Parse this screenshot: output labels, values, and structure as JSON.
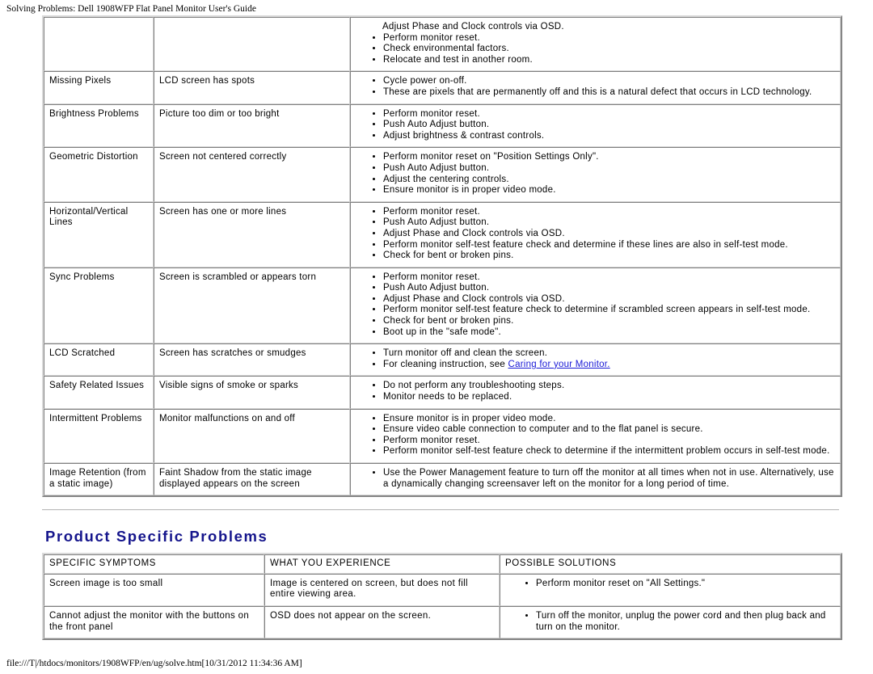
{
  "header": {
    "title": "Solving Problems: Dell 1908WFP Flat Panel Monitor User's Guide"
  },
  "footer": {
    "path": "file:///T|/htdocs/monitors/1908WFP/en/ug/solve.htm[10/31/2012 11:34:36 AM]"
  },
  "monitor_problems_table": {
    "rows": [
      {
        "symptom": "",
        "experience": "",
        "solutions": [
          "Adjust Phase and Clock controls via OSD.",
          "Perform monitor reset.",
          "Check environmental factors.",
          "Relocate and test in another room."
        ],
        "first_solution_no_bullet": true
      },
      {
        "symptom": "Missing Pixels",
        "experience": "LCD screen has spots",
        "solutions": [
          "Cycle power on-off.",
          "These are pixels that are permanently off and this is a natural defect that occurs in LCD technology."
        ]
      },
      {
        "symptom": "Brightness Problems",
        "experience": "Picture too dim or too bright",
        "solutions": [
          "Perform monitor reset.",
          "Push Auto Adjust button.",
          "Adjust brightness & contrast controls."
        ]
      },
      {
        "symptom": "Geometric Distortion",
        "experience": "Screen not centered correctly",
        "solutions": [
          "Perform monitor reset on \"Position Settings Only\".",
          "Push Auto Adjust button.",
          "Adjust the centering controls.",
          "Ensure monitor is in proper video mode."
        ]
      },
      {
        "symptom": "Horizontal/Vertical Lines",
        "experience": "Screen has one or more lines",
        "solutions": [
          "Perform monitor reset.",
          "Push Auto Adjust button.",
          "Adjust Phase and Clock controls via OSD.",
          "Perform monitor self-test feature check and determine if these lines are also in self-test mode.",
          "Check for bent or broken pins."
        ]
      },
      {
        "symptom": "Sync Problems",
        "experience": "Screen is scrambled or appears torn",
        "solutions": [
          "Perform monitor reset.",
          "Push Auto Adjust button.",
          "Adjust Phase and Clock controls via OSD.",
          "Perform monitor self-test feature check to determine if scrambled screen appears in self-test mode.",
          "Check for bent or broken pins.",
          "Boot up in the \"safe mode\"."
        ]
      },
      {
        "symptom": "LCD Scratched",
        "experience": "Screen has scratches or smudges",
        "solutions": [
          "Turn monitor off and clean the screen.",
          "For cleaning instruction, see "
        ],
        "link_in_last": {
          "text": "Caring for your Monitor. "
        }
      },
      {
        "symptom": "Safety Related Issues",
        "experience": "Visible signs of smoke or sparks",
        "solutions": [
          "Do not perform any troubleshooting steps.",
          "Monitor needs to be replaced."
        ]
      },
      {
        "symptom": "Intermittent Problems",
        "experience": "Monitor malfunctions on and off",
        "solutions": [
          "Ensure monitor is in proper video mode.",
          "Ensure video cable connection to computer and to the flat panel is secure.",
          "Perform monitor reset.",
          "Perform monitor self-test feature check to determine if the intermittent problem occurs in self-test mode."
        ]
      },
      {
        "symptom": "Image Retention (from a static image)",
        "experience": "Faint Shadow from the static image displayed appears on the screen",
        "solutions": [
          "Use the Power Management feature to turn off the monitor at all times when not in use. Alternatively, use a dynamically changing screensaver left on the monitor for a long period of time."
        ]
      }
    ]
  },
  "product_specific": {
    "heading": "Product Specific Problems",
    "columns": {
      "symptoms": "SPECIFIC SYMPTOMS",
      "experience": "WHAT YOU EXPERIENCE",
      "solutions": "POSSIBLE SOLUTIONS"
    },
    "rows": [
      {
        "symptom": "Screen image is too small",
        "experience": "Image is centered on screen, but does not fill entire viewing area.",
        "solutions": [
          "Perform monitor reset on \"All Settings.\""
        ]
      },
      {
        "symptom": "Cannot adjust the monitor with the buttons on the front panel",
        "experience": "OSD does not appear on the screen.",
        "solutions": [
          "Turn off the monitor, unplug the power cord and then plug back and turn on the monitor."
        ]
      }
    ]
  },
  "colors": {
    "heading": "#15158c",
    "link": "#1818d6",
    "text": "#000000",
    "border": "#d4d4d4"
  }
}
